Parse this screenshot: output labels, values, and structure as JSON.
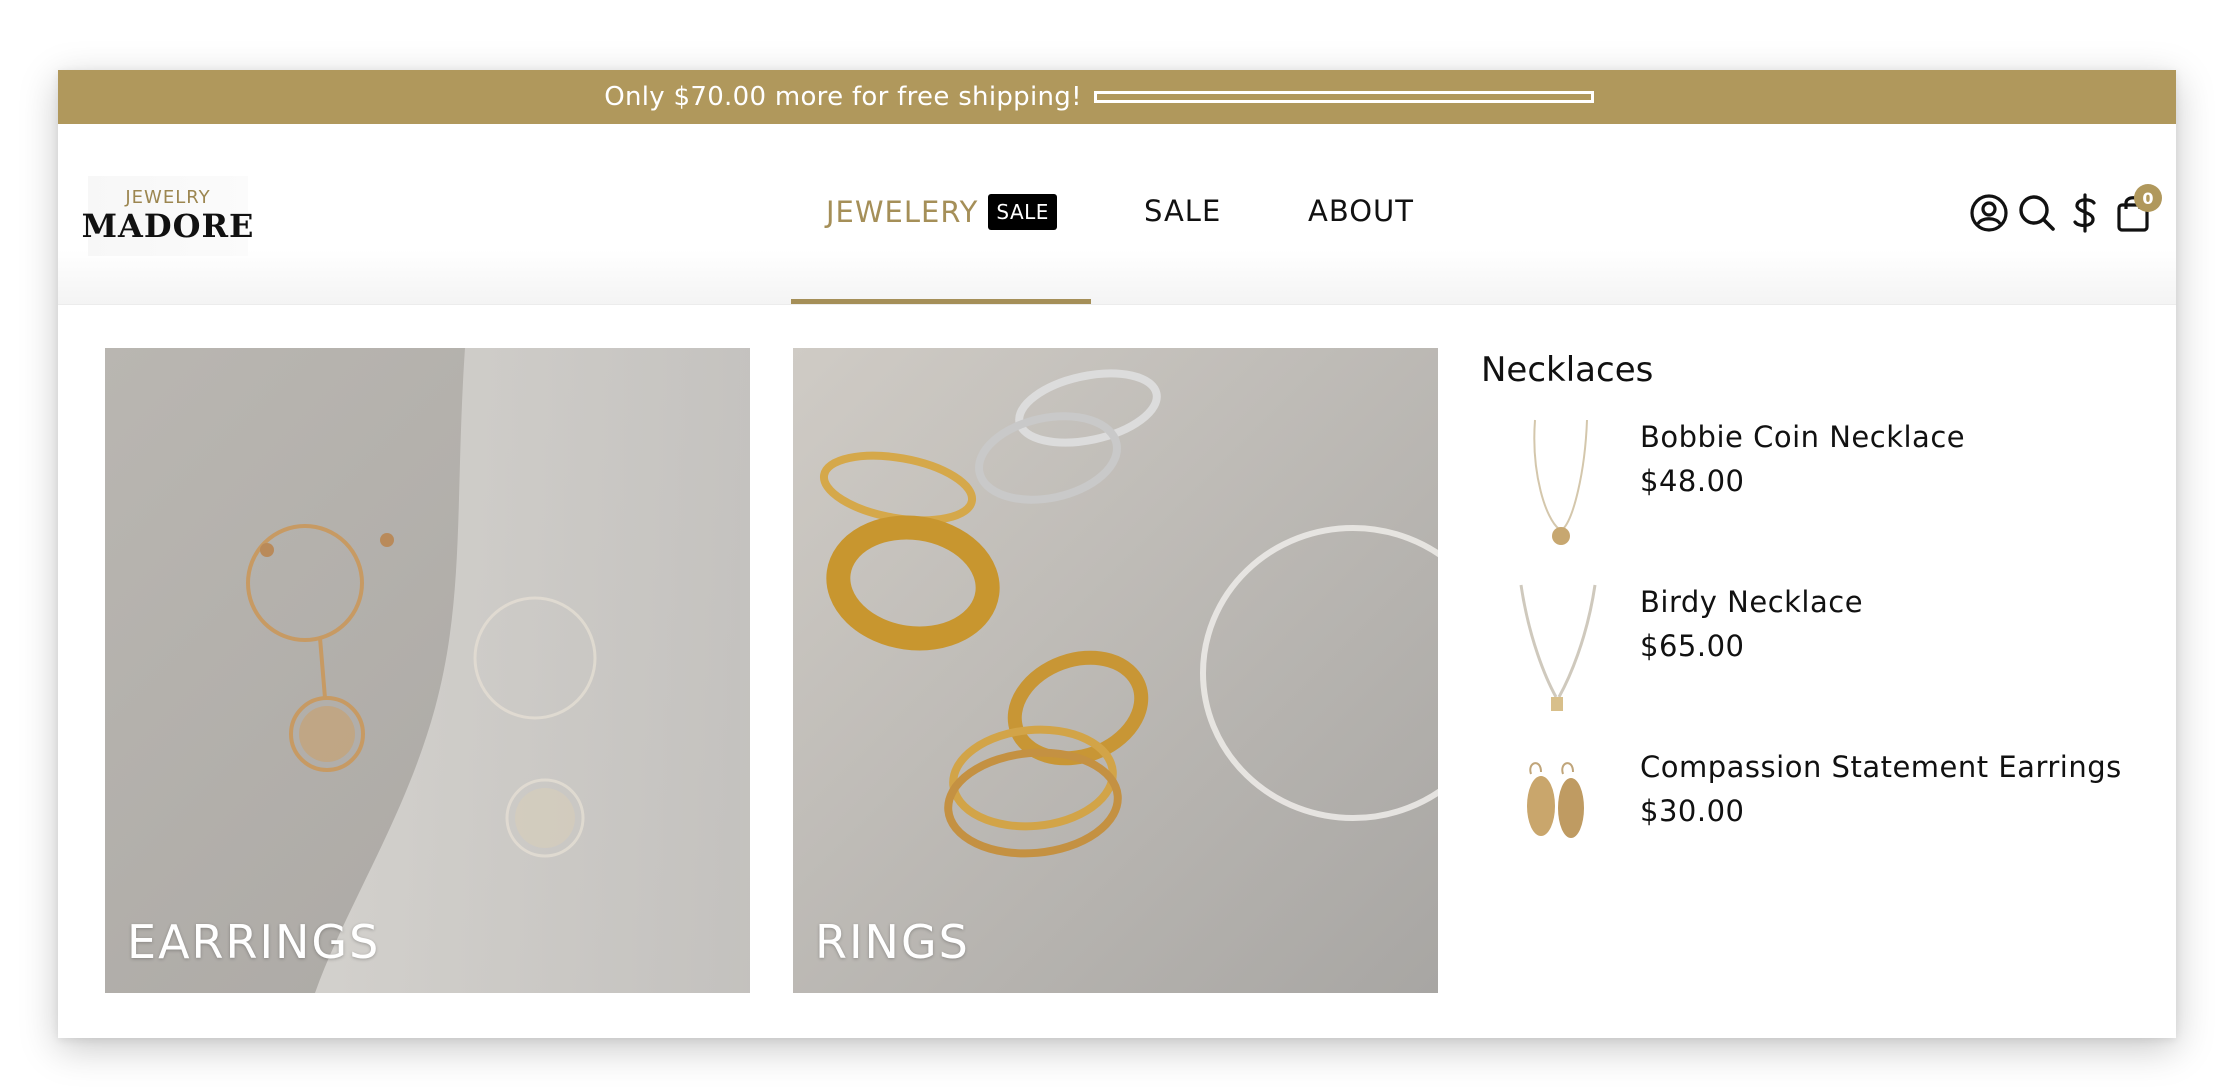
{
  "announcement": {
    "text": "Only $70.00 more for free shipping!",
    "progress_fraction": 0.0
  },
  "logo": {
    "top": "JEWELRY",
    "main": "MADORE"
  },
  "nav": {
    "items": [
      {
        "label": "JEWELERY",
        "badge": "SALE",
        "active": true
      },
      {
        "label": "SALE"
      },
      {
        "label": "ABOUT"
      }
    ]
  },
  "header_icons": {
    "account": "account-icon",
    "search": "search-icon",
    "currency": "currency-icon",
    "cart": "cart-icon",
    "cart_count": "0"
  },
  "mega_menu": {
    "tiles": [
      {
        "label": "EARRINGS"
      },
      {
        "label": "RINGS"
      }
    ],
    "collection": {
      "title": "Necklaces",
      "products": [
        {
          "name": "Bobbie Coin Necklace",
          "price": "$48.00"
        },
        {
          "name": "Birdy Necklace",
          "price": "$65.00"
        },
        {
          "name": "Compassion Statement Earrings",
          "price": "$30.00"
        }
      ]
    }
  },
  "colors": {
    "accent": "#b0985c",
    "text": "#111111"
  }
}
